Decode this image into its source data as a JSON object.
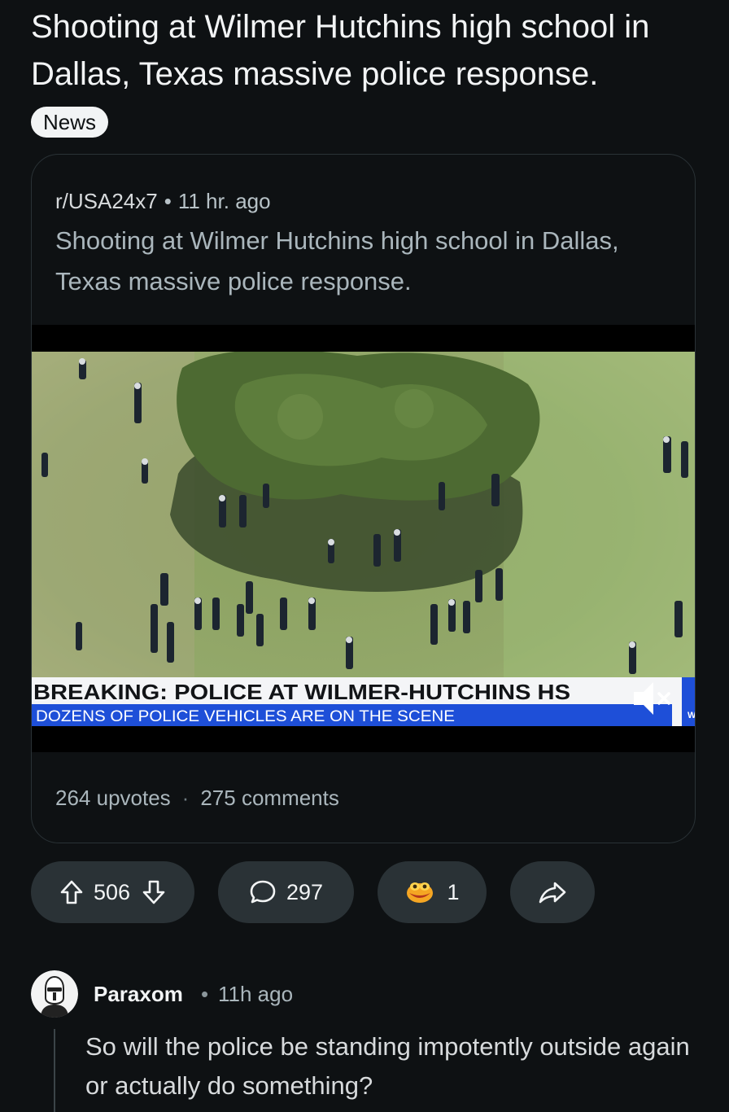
{
  "post": {
    "title": "Shooting at Wilmer Hutchins high school in Dallas, Texas massive police response.",
    "flair": "News"
  },
  "crosspost": {
    "subreddit": "r/USA24x7",
    "separator": "•",
    "age": "11 hr. ago",
    "title": "Shooting at Wilmer Hutchins high school in Dallas, Texas massive police response.",
    "video": {
      "headline": "BREAKING: POLICE AT WILMER-HUTCHINS HS",
      "ticker": "DOZENS OF POLICE VEHICLES ARE ON THE SCENE",
      "logo_letter": "W",
      "muted": true
    },
    "upvotes": "264 upvotes",
    "stats_separator": "·",
    "comments": "275 comments"
  },
  "actions": {
    "vote_count": "506",
    "comment_count": "297",
    "award_count": "1"
  },
  "comment": {
    "author": "Paraxom",
    "separator": "•",
    "age": "11h ago",
    "body": "So will the police be standing impotently outside again or actually do something?"
  },
  "colors": {
    "background": "#0e1113",
    "pill": "#2a3236",
    "ticker_blue": "#1e4fd8",
    "award_orange": "#f5a623"
  },
  "icons": {
    "upvote": "arrow-up-icon",
    "downvote": "arrow-down-icon",
    "comment": "speech-bubble-icon",
    "award": "award-icon",
    "share": "share-arrow-icon",
    "mute": "speaker-muted-icon"
  }
}
